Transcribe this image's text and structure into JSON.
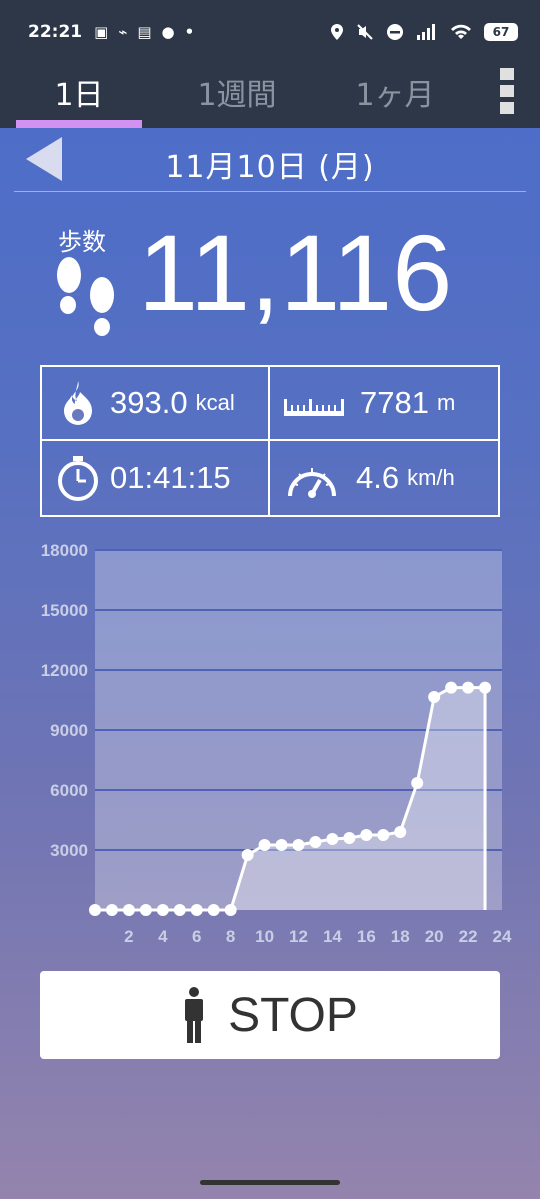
{
  "status_bar": {
    "time": "22:21",
    "battery": "67",
    "icons": [
      "gallery-icon",
      "activity-icon",
      "news-icon",
      "line-icon",
      "dot-icon",
      "location-icon",
      "mute-icon",
      "dnd-icon",
      "signal-icon",
      "wifi-icon",
      "battery-icon"
    ]
  },
  "tabs": [
    {
      "label": "1日",
      "active": true
    },
    {
      "label": "1週間",
      "active": false
    },
    {
      "label": "1ヶ月",
      "active": false
    }
  ],
  "colors": {
    "tab_indicator": "#d292f2",
    "header_bg": "#2d3748",
    "chart_line": "#ffffff"
  },
  "date_header": {
    "date": "11月10日 (月)"
  },
  "steps": {
    "label": "歩数",
    "value": "11,116"
  },
  "stats": {
    "calories": {
      "value": "393.0",
      "unit": "kcal"
    },
    "distance": {
      "value": "7781",
      "unit": "m"
    },
    "duration": {
      "value": "01:41:15"
    },
    "speed": {
      "value": "4.6",
      "unit": "km/h"
    }
  },
  "chart_data": {
    "type": "area",
    "title": "",
    "xlabel": "",
    "ylabel": "",
    "x": [
      0,
      1,
      2,
      3,
      4,
      5,
      6,
      7,
      8,
      9,
      10,
      11,
      12,
      13,
      14,
      15,
      16,
      17,
      18,
      19,
      20,
      21,
      22,
      23
    ],
    "values": [
      0,
      0,
      0,
      0,
      0,
      0,
      0,
      0,
      0,
      2750,
      3250,
      3250,
      3250,
      3400,
      3550,
      3600,
      3750,
      3750,
      3900,
      6350,
      10650,
      11116,
      11116,
      11116
    ],
    "ylim": [
      0,
      18000
    ],
    "xlim": [
      0,
      24
    ],
    "y_ticks": [
      "18000",
      "15000",
      "12000",
      "9000",
      "6000",
      "3000"
    ],
    "x_ticks": [
      "2",
      "4",
      "6",
      "8",
      "10",
      "12",
      "14",
      "16",
      "18",
      "20",
      "22",
      "24"
    ],
    "grid": true
  },
  "stop_button": {
    "label": "STOP"
  }
}
